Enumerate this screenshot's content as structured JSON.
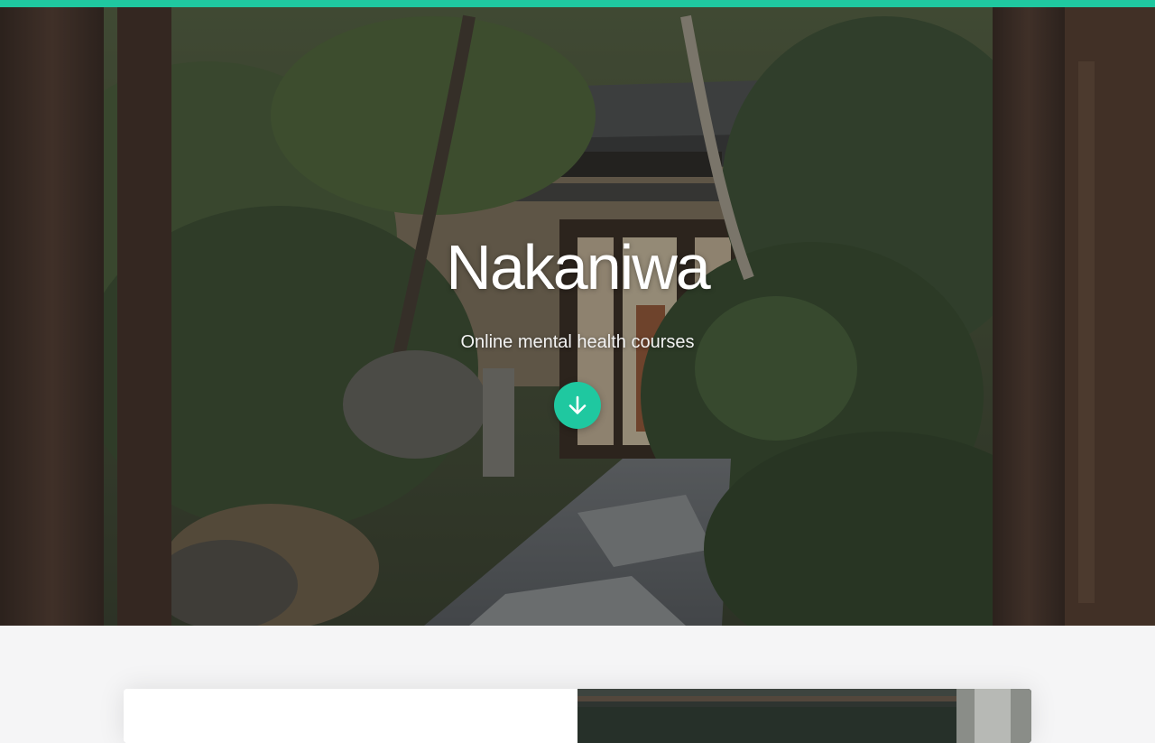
{
  "theme": {
    "accent": "#1fc8a0",
    "background": "#f5f5f6"
  },
  "hero": {
    "title": "Nakaniwa",
    "subtitle": "Online mental health courses",
    "scroll_icon": "arrow-down-icon"
  }
}
